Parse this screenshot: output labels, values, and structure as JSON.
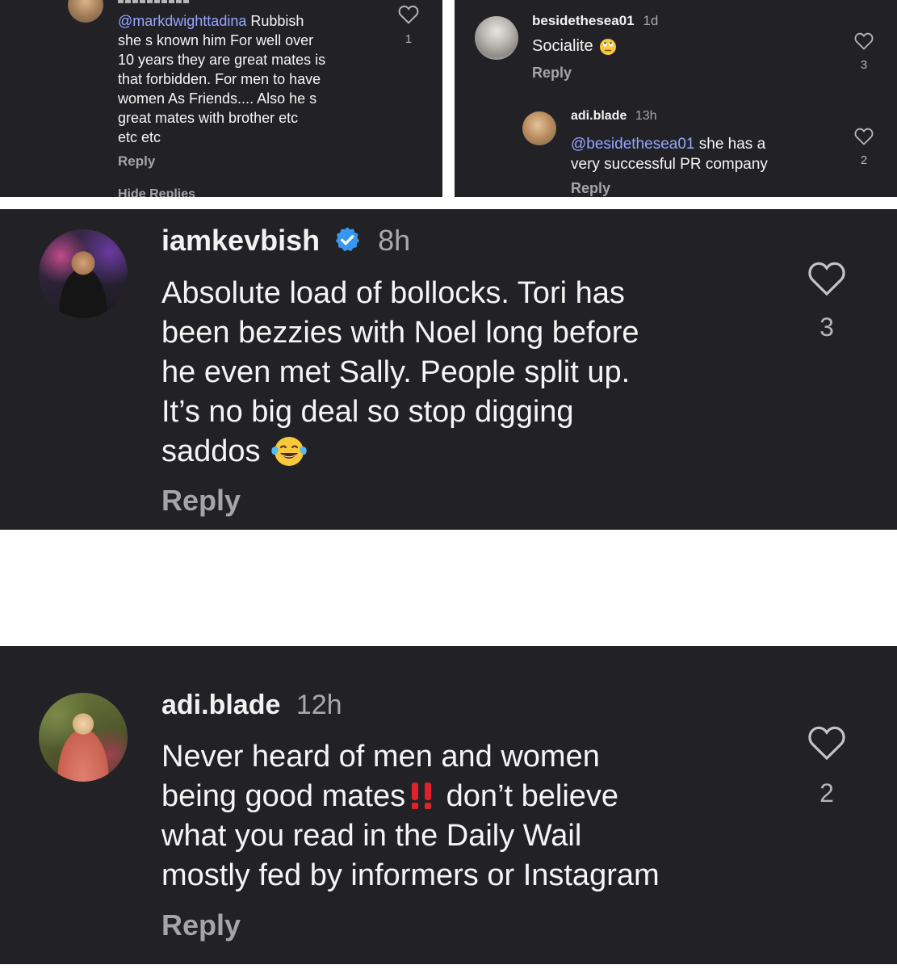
{
  "panel_top_left": {
    "comment_text": "Rubbish she s known him For well over 10 years they are great mates is that forbidden. For men to have women As Friends.... Also he s great mates with brother etc etc etc",
    "mention": "@markdwighttadina",
    "text_lines": [
      " Rubbish",
      "she s known him For well over",
      "10 years they are great mates is",
      "that forbidden. For men to have",
      "women As Friends.... Also he s",
      "great mates with brother etc",
      "etc etc"
    ],
    "reply_label": "Reply",
    "like_count": "1",
    "hide_replies_label": "Hide Replies"
  },
  "panel_top_right": {
    "comment": {
      "username": "besidethesea01",
      "time": "1d",
      "text": "Socialite",
      "emoji": "eye-roll-emoji",
      "reply_label": "Reply",
      "like_count": "3"
    },
    "reply": {
      "username": "adi.blade",
      "time": "13h",
      "mention": "@besidethesea01",
      "text_lines": [
        " she has a",
        "very successful PR company"
      ],
      "reply_label": "Reply",
      "like_count": "2"
    }
  },
  "panel_middle": {
    "username": "iamkevbish",
    "verified_icon": "verified-badge-icon",
    "time": "8h",
    "text_lines": [
      "Absolute load of bollocks. Tori has",
      "been bezzies with Noel long before",
      "he even met Sally. People split up.",
      "It’s no big deal so stop digging",
      "saddos"
    ],
    "emoji": "laughing-tears-emoji",
    "reply_label": "Reply",
    "like_count": "3"
  },
  "panel_bottom": {
    "username": "adi.blade",
    "time": "12h",
    "text_lines": [
      "Never heard of men and women",
      "being good mates",
      " don’t believe",
      "what you read in the Daily Wail",
      "mostly fed by informers or Instagram"
    ],
    "emoji": "double-exclamation-emoji",
    "reply_label": "Reply",
    "like_count": "2"
  },
  "colors": {
    "panel_bg": "#222226",
    "mention": "#97a6ff",
    "muted": "#a4a4a9",
    "exclamation": "#e0202a",
    "verified": "#3897f0"
  }
}
